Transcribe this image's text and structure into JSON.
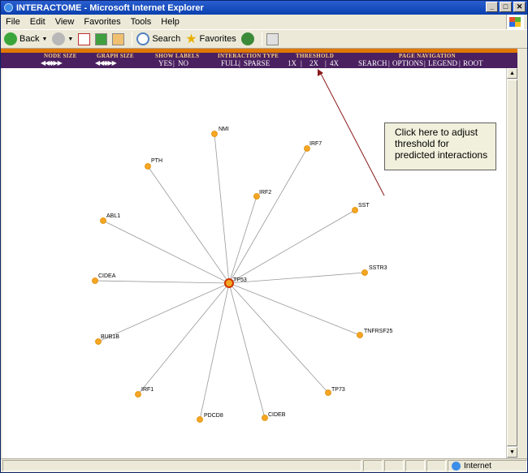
{
  "window": {
    "title": "INTERACTOME - Microsoft Internet Explorer",
    "controls": [
      "_",
      "□",
      "✕"
    ]
  },
  "menu": [
    "File",
    "Edit",
    "View",
    "Favorites",
    "Tools",
    "Help"
  ],
  "toolbar": {
    "back": "Back",
    "search": "Search",
    "favorites": "Favorites"
  },
  "nav": {
    "node_size": {
      "header": "NODE SIZE",
      "arrows": "◀◀◆▶▶"
    },
    "graph_size": {
      "header": "GRAPH SIZE",
      "arrows": "◀◀◆▶▶"
    },
    "show_labels": {
      "header": "SHOW LABELS",
      "yes": "YES",
      "sep": "|",
      "no": "NO"
    },
    "interaction_type": {
      "header": "INTERACTION TYPE",
      "full": "FULL",
      "sep": "|",
      "sparse": "SPARSE"
    },
    "threshold": {
      "header": "THRESHOLD",
      "x1": "1X",
      "sep1": "|",
      "x2": "2X",
      "sep2": "|",
      "x4": "4X"
    },
    "page_navigation": {
      "header": "PAGE NAVIGATION",
      "search": "SEARCH",
      "sep1": "|",
      "options": "OPTIONS",
      "sep2": "|",
      "legend": "LEGEND",
      "sep3": "|",
      "root": "ROOT"
    }
  },
  "callout": {
    "text": "Click here to adjust threshold for predicted interactions"
  },
  "graph": {
    "center": "TP53",
    "nodes": [
      "NMI",
      "IRF7",
      "PTH",
      "IRF2",
      "SST",
      "ABL1",
      "SSTR3",
      "CIDEA",
      "TNFRSF25",
      "BUB1B",
      "TP73",
      "IRF1",
      "CIDEB",
      "PDCD8"
    ],
    "colors": {
      "node": "#f5a623",
      "node_stroke": "#e08a00",
      "center_stroke": "#cc3300",
      "edge": "#999999"
    }
  },
  "status": {
    "zone": "Internet"
  }
}
